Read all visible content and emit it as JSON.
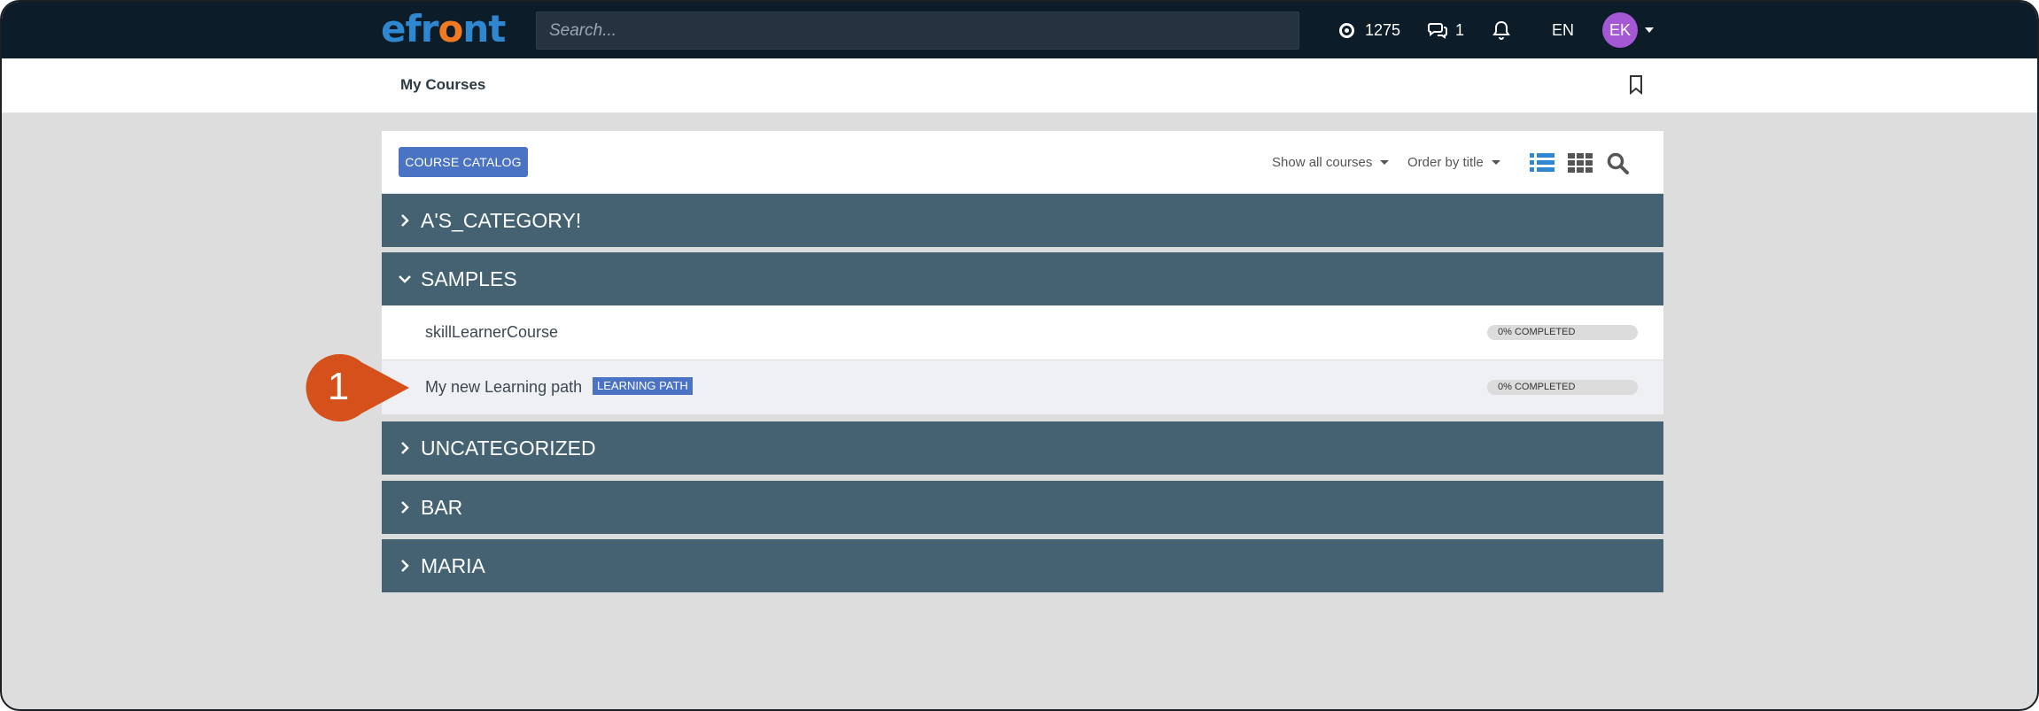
{
  "topbar": {
    "logo_prefix": "efr",
    "logo_o": "o",
    "logo_suffix": "nt",
    "search_placeholder": "Search...",
    "points": "1275",
    "messages": "1",
    "language": "EN",
    "avatar_initials": "EK",
    "icons": [
      "target-icon",
      "chat-icon",
      "bell-icon",
      "caret-down-icon"
    ]
  },
  "subbar": {
    "title": "My Courses",
    "icons": [
      "bookmark-icon"
    ]
  },
  "toolbar": {
    "catalog_button": "COURSE CATALOG",
    "filter_dropdown": "Show all courses",
    "order_dropdown": "Order by title",
    "icons": [
      "list-view-icon",
      "grid-view-icon",
      "search-icon"
    ]
  },
  "categories": [
    {
      "name": "A'S_CATEGORY!",
      "expanded": false
    },
    {
      "name": "SAMPLES",
      "expanded": true,
      "courses": [
        {
          "name": "skillLearnerCourse",
          "progress": 0,
          "progress_label": "0% COMPLETED"
        },
        {
          "name": "My new Learning path",
          "badge": "LEARNING PATH",
          "progress": 0,
          "progress_label": "0% COMPLETED"
        }
      ]
    },
    {
      "name": "UNCATEGORIZED",
      "expanded": false
    },
    {
      "name": "BAR",
      "expanded": false
    },
    {
      "name": "MARIA",
      "expanded": false
    }
  ],
  "callout": {
    "number": "1"
  },
  "colors": {
    "topbar": "#0d1c29",
    "category": "#446271",
    "accent_blue": "#4a73c4",
    "logo_blue": "#2f87cf",
    "logo_orange": "#ef7a21",
    "callout": "#d5501a",
    "avatar": "#a558d4"
  }
}
